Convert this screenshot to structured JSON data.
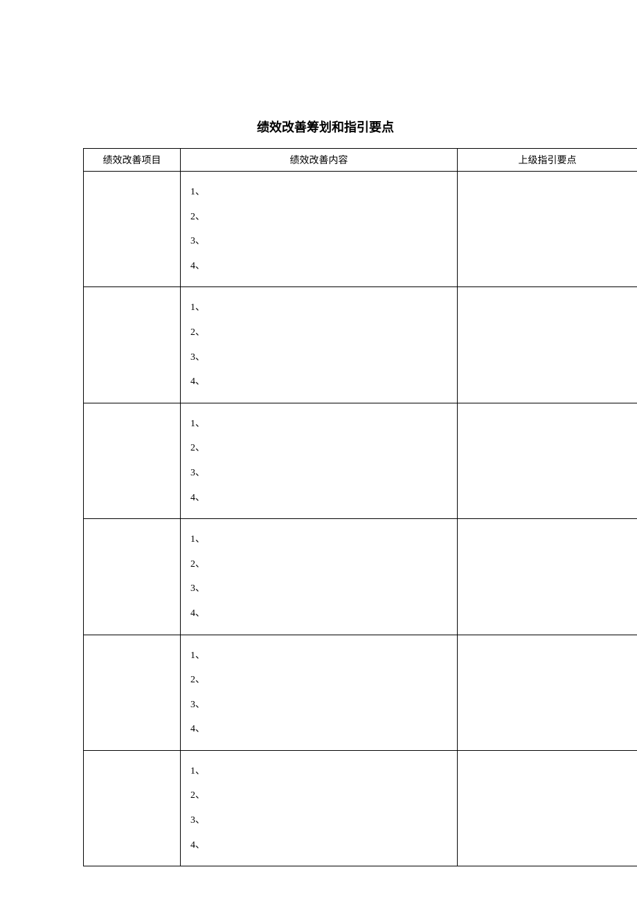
{
  "title": "绩效改善筹划和指引要点",
  "headers": {
    "project": "绩效改善项目",
    "content": "绩效改善内容",
    "guide": "上级指引要点"
  },
  "rows": [
    {
      "project": "",
      "items": [
        "1、",
        "2、",
        "3、",
        "4、"
      ],
      "guide": ""
    },
    {
      "project": "",
      "items": [
        "1、",
        "2、",
        "3、",
        "4、"
      ],
      "guide": ""
    },
    {
      "project": "",
      "items": [
        "1、",
        "2、",
        "3、",
        "4、"
      ],
      "guide": ""
    },
    {
      "project": "",
      "items": [
        "1、",
        "2、",
        "3、",
        "4、"
      ],
      "guide": ""
    },
    {
      "project": "",
      "items": [
        "1、",
        "2、",
        "3、",
        "4、"
      ],
      "guide": ""
    },
    {
      "project": "",
      "items": [
        "1、",
        "2、",
        "3、",
        "4、"
      ],
      "guide": ""
    }
  ]
}
